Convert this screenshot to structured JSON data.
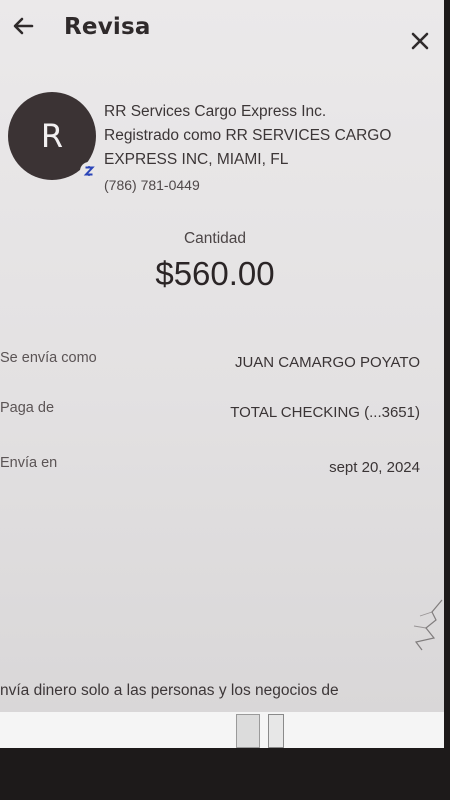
{
  "header": {
    "title": "Revisa"
  },
  "merchant": {
    "avatar_letter": "R",
    "name": "RR Services Cargo Express Inc.",
    "registered_line1": "Registrado como RR SERVICES CARGO",
    "registered_line2": "EXPRESS INC, MIAMI, FL",
    "phone": "(786) 781-0449"
  },
  "amount": {
    "label": "Cantidad",
    "value": "$560.00"
  },
  "details": [
    {
      "label": "Se envía como",
      "value": "JUAN CAMARGO POYATO"
    },
    {
      "label": "Paga de",
      "value": "TOTAL CHECKING (...3651)"
    },
    {
      "label": "Envía en",
      "value": "sept 20, 2024"
    }
  ],
  "footer": {
    "text": "nvía dinero solo a las personas y los negocios de"
  },
  "icons": {
    "back": "back-arrow-icon",
    "close": "close-icon",
    "badge": "zelle-icon"
  }
}
